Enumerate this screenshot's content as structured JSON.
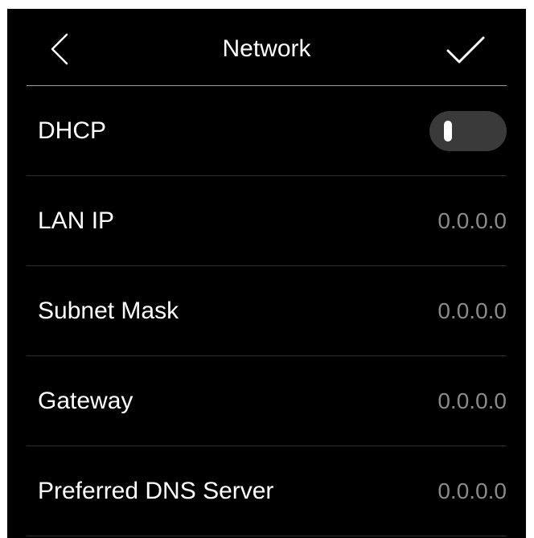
{
  "header": {
    "title": "Network",
    "back_icon": "chevron-left-icon",
    "confirm_icon": "checkmark-icon"
  },
  "colors": {
    "background": "#000000",
    "text": "#ffffff",
    "value_text": "#8a8a8a",
    "toggle_track": "#3a3a3a"
  },
  "settings": {
    "dhcp": {
      "label": "DHCP",
      "enabled": false
    },
    "lan_ip": {
      "label": "LAN IP",
      "value": "0.0.0.0"
    },
    "subnet_mask": {
      "label": "Subnet Mask",
      "value": "0.0.0.0"
    },
    "gateway": {
      "label": "Gateway",
      "value": "0.0.0.0"
    },
    "preferred_dns": {
      "label": "Preferred DNS Server",
      "value": "0.0.0.0"
    }
  }
}
